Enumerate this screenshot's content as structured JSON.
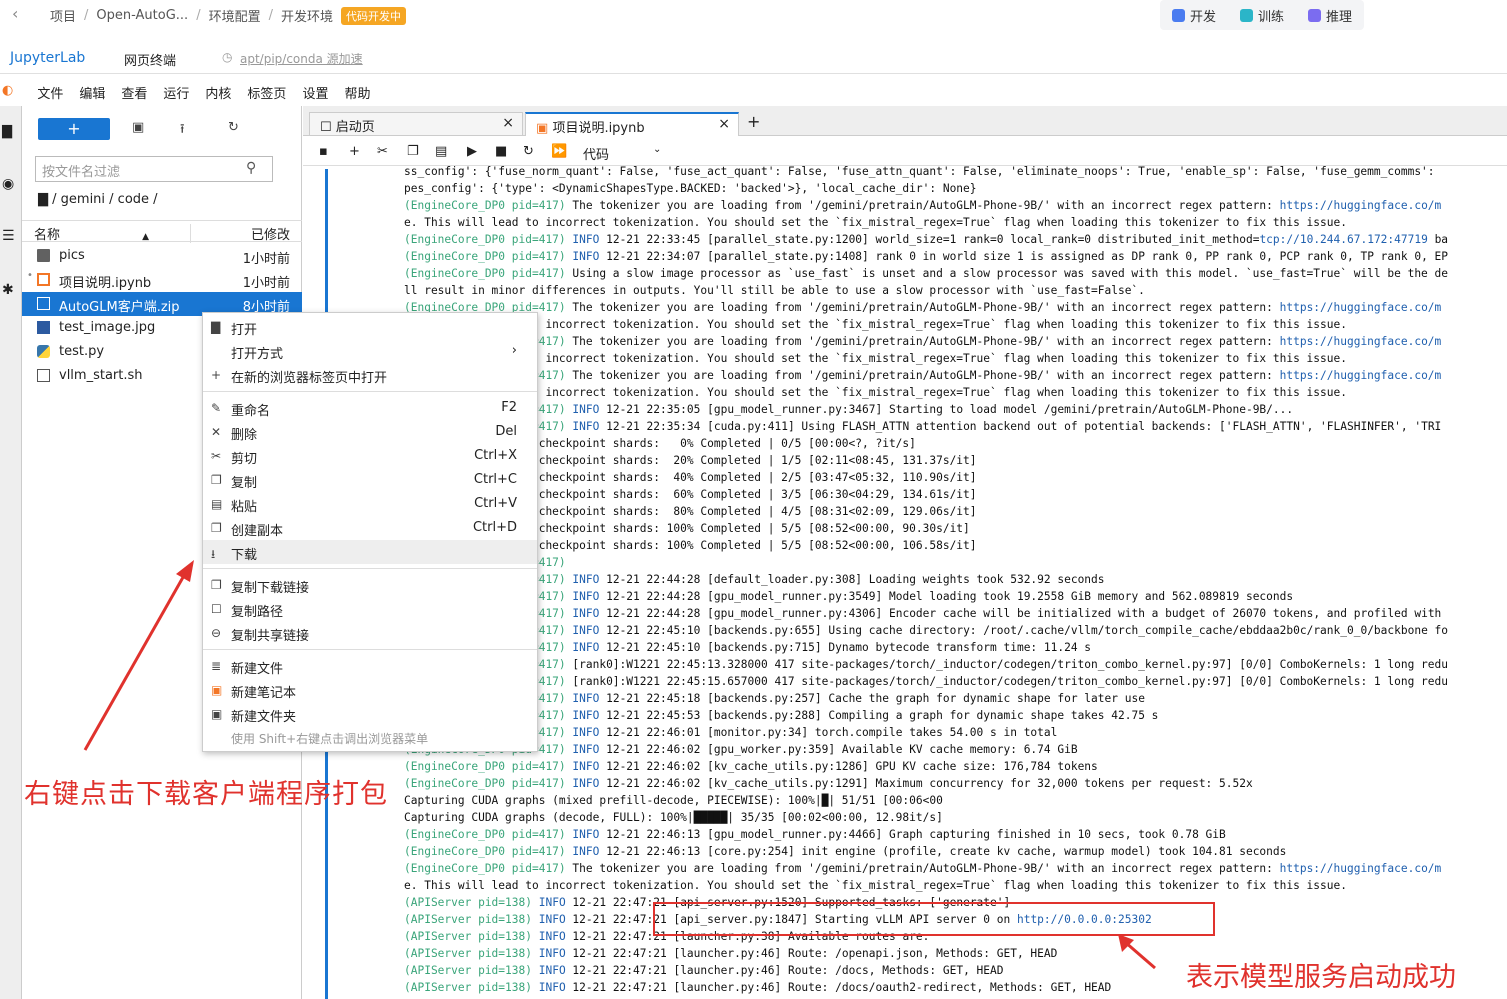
{
  "topbar": {
    "back_icon": "chevron-left-icon",
    "breadcrumb": [
      "项目",
      "Open-AutoG...",
      "环境配置",
      "开发环境"
    ],
    "status_badge": "代码开发中",
    "modes": [
      {
        "label": "开发",
        "color": "#4a7cf0"
      },
      {
        "label": "训练",
        "color": "#2bb5c8"
      },
      {
        "label": "推理",
        "color": "#7b6cf0"
      }
    ]
  },
  "jl": {
    "title": "JupyterLab",
    "terminal": "网页终端",
    "mirror": "apt/pip/conda 源加速"
  },
  "menu": [
    "文件",
    "编辑",
    "查看",
    "运行",
    "内核",
    "标签页",
    "设置",
    "帮助"
  ],
  "filebrowser": {
    "new_label": "+",
    "filter_placeholder": "按文件名过滤",
    "path": "/ gemini / code /",
    "col_name": "名称",
    "col_modified": "已修改",
    "files": [
      {
        "name": "pics",
        "modified": "1小时前",
        "icon": "folder-icon"
      },
      {
        "name": "项目说明.ipynb",
        "modified": "1小时前",
        "icon": "notebook-icon"
      },
      {
        "name": "AutoGLM客户端.zip",
        "modified": "8小时前",
        "icon": "file-icon"
      },
      {
        "name": "test_image.jpg",
        "modified": "",
        "icon": "image-icon"
      },
      {
        "name": "test.py",
        "modified": "",
        "icon": "python-icon"
      },
      {
        "name": "vllm_start.sh",
        "modified": "",
        "icon": "file-icon"
      }
    ]
  },
  "tabs": [
    {
      "label": "启动页",
      "close": "×"
    },
    {
      "label": "项目说明.ipynb",
      "close": "×"
    }
  ],
  "nb": {
    "cell_type": "代码",
    "add_tab": "+"
  },
  "context_menu": [
    {
      "label": "打开",
      "key": "",
      "icon": "folder-icon"
    },
    {
      "label": "打开方式",
      "key": "›",
      "icon": ""
    },
    {
      "label": "在新的浏览器标签页中打开",
      "key": "",
      "icon": "plus-icon"
    },
    {
      "label": "重命名",
      "key": "F2",
      "icon": "pencil-icon"
    },
    {
      "label": "删除",
      "key": "Del",
      "icon": "close-icon"
    },
    {
      "label": "剪切",
      "key": "Ctrl+X",
      "icon": "scissors-icon"
    },
    {
      "label": "复制",
      "key": "Ctrl+C",
      "icon": "copy-icon"
    },
    {
      "label": "粘贴",
      "key": "Ctrl+V",
      "icon": "paste-icon"
    },
    {
      "label": "创建副本",
      "key": "Ctrl+D",
      "icon": "duplicate-icon"
    },
    {
      "label": "下载",
      "key": "",
      "icon": "download-icon"
    },
    {
      "label": "复制下载链接",
      "key": "",
      "icon": "copy-icon"
    },
    {
      "label": "复制路径",
      "key": "",
      "icon": "file-icon"
    },
    {
      "label": "复制共享链接",
      "key": "",
      "icon": "link-icon"
    },
    {
      "label": "新建文件",
      "key": "",
      "icon": "text-file-icon"
    },
    {
      "label": "新建笔记本",
      "key": "",
      "icon": "notebook-icon"
    },
    {
      "label": "新建文件夹",
      "key": "",
      "icon": "new-folder-icon"
    },
    {
      "label": "使用 Shift+右键点击调出浏览器菜单",
      "key": "",
      "icon": ""
    }
  ],
  "annotations": {
    "left": "右键点击下载客户端程序打包",
    "right": "表示模型服务启动成功"
  },
  "output_lines": [
    "ss_config': {'fuse_norm_quant': False, 'fuse_act_quant': False, 'fuse_attn_quant': False, 'eliminate_noops': True, 'enable_sp': False, 'fuse_gemm_comms':",
    "pes_config': {'type': <DynamicShapesType.BACKED: 'backed'>}, 'local_cache_dir': None}",
    "(EngineCore_DP0 pid=417) The tokenizer you are loading from '/gemini/pretrain/AutoGLM-Phone-9B/' with an incorrect regex pattern: https://huggingface.co/m",
    "e. This will lead to incorrect tokenization. You should set the `fix_mistral_regex=True` flag when loading this tokenizer to fix this issue.",
    "(EngineCore_DP0 pid=417) INFO 12-21 22:33:45 [parallel_state.py:1200] world_size=1 rank=0 local_rank=0 distributed_init_method=tcp://10.244.67.172:47719 ba",
    "(EngineCore_DP0 pid=417) INFO 12-21 22:34:07 [parallel_state.py:1408] rank 0 in world size 1 is assigned as DP rank 0, PP rank 0, PCP rank 0, TP rank 0, EP",
    "(EngineCore_DP0 pid=417) Using a slow image processor as `use_fast` is unset and a slow processor was saved with this model. `use_fast=True` will be the de",
    "ll result in minor differences in outputs. You'll still be able to use a slow processor with `use_fast=False`.",
    "(EngineCore_DP0 pid=417) The tokenizer you are loading from '/gemini/pretrain/AutoGLM-Phone-9B/' with an incorrect regex pattern: https://huggingface.co/m",
    "e. This will lead to incorrect tokenization. You should set the `fix_mistral_regex=True` flag when loading this tokenizer to fix this issue.",
    "(EngineCore_DP0 pid=417) The tokenizer you are loading from '/gemini/pretrain/AutoGLM-Phone-9B/' with an incorrect regex pattern: https://huggingface.co/m",
    "e. This will lead to incorrect tokenization. You should set the `fix_mistral_regex=True` flag when loading this tokenizer to fix this issue.",
    "(EngineCore_DP0 pid=417) The tokenizer you are loading from '/gemini/pretrain/AutoGLM-Phone-9B/' with an incorrect regex pattern: https://huggingface.co/m",
    "e. This will lead to incorrect tokenization. You should set the `fix_mistral_regex=True` flag when loading this tokenizer to fix this issue.",
    "(EngineCore_DP0 pid=417) INFO 12-21 22:35:05 [gpu_model_runner.py:3467] Starting to load model /gemini/pretrain/AutoGLM-Phone-9B/...",
    "(EngineCore_DP0 pid=417) INFO 12-21 22:35:34 [cuda.py:411] Using FLASH_ATTN attention backend out of potential backends: ['FLASH_ATTN', 'FLASHINFER', 'TRI",
    "Loading safetensors checkpoint shards:   0% Completed | 0/5 [00:00<?, ?it/s]",
    "Loading safetensors checkpoint shards:  20% Completed | 1/5 [02:11<08:45, 131.37s/it]",
    "Loading safetensors checkpoint shards:  40% Completed | 2/5 [03:47<05:32, 110.90s/it]",
    "Loading safetensors checkpoint shards:  60% Completed | 3/5 [06:30<04:29, 134.61s/it]",
    "Loading safetensors checkpoint shards:  80% Completed | 4/5 [08:31<02:09, 129.06s/it]",
    "Loading safetensors checkpoint shards: 100% Completed | 5/5 [08:52<00:00, 90.30s/it]",
    "Loading safetensors checkpoint shards: 100% Completed | 5/5 [08:52<00:00, 106.58s/it]",
    "(EngineCore_DP0 pid=417)",
    "(EngineCore_DP0 pid=417) INFO 12-21 22:44:28 [default_loader.py:308] Loading weights took 532.92 seconds",
    "(EngineCore_DP0 pid=417) INFO 12-21 22:44:28 [gpu_model_runner.py:3549] Model loading took 19.2558 GiB memory and 562.089819 seconds",
    "(EngineCore_DP0 pid=417) INFO 12-21 22:44:28 [gpu_model_runner.py:4306] Encoder cache will be initialized with a budget of 26070 tokens, and profiled with",
    "(EngineCore_DP0 pid=417) INFO 12-21 22:45:10 [backends.py:655] Using cache directory: /root/.cache/vllm/torch_compile_cache/ebddaa2b0c/rank_0_0/backbone fo",
    "(EngineCore_DP0 pid=417) INFO 12-21 22:45:10 [backends.py:715] Dynamo bytecode transform time: 11.24 s",
    "(EngineCore_DP0 pid=417) [rank0]:W1221 22:45:13.328000 417 site-packages/torch/_inductor/codegen/triton_combo_kernel.py:97] [0/0] ComboKernels: 1 long redu",
    "(EngineCore_DP0 pid=417) [rank0]:W1221 22:45:15.657000 417 site-packages/torch/_inductor/codegen/triton_combo_kernel.py:97] [0/0] ComboKernels: 1 long redu",
    "(EngineCore_DP0 pid=417) INFO 12-21 22:45:18 [backends.py:257] Cache the graph for dynamic shape for later use",
    "(EngineCore_DP0 pid=417) INFO 12-21 22:45:53 [backends.py:288] Compiling a graph for dynamic shape takes 42.75 s",
    "(EngineCore_DP0 pid=417) INFO 12-21 22:46:01 [monitor.py:34] torch.compile takes 54.00 s in total",
    "(EngineCore_DP0 pid=417) INFO 12-21 22:46:02 [gpu_worker.py:359] Available KV cache memory: 6.74 GiB",
    "(EngineCore_DP0 pid=417) INFO 12-21 22:46:02 [kv_cache_utils.py:1286] GPU KV cache size: 176,784 tokens",
    "(EngineCore_DP0 pid=417) INFO 12-21 22:46:02 [kv_cache_utils.py:1291] Maximum concurrency for 32,000 tokens per request: 5.52x",
    "Capturing CUDA graphs (mixed prefill-decode, PIECEWISE): 100%|█| 51/51 [00:06<00",
    "Capturing CUDA graphs (decode, FULL): 100%|█████| 35/35 [00:02<00:00, 12.98it/s]",
    "(EngineCore_DP0 pid=417) INFO 12-21 22:46:13 [gpu_model_runner.py:4466] Graph capturing finished in 10 secs, took 0.78 GiB",
    "(EngineCore_DP0 pid=417) INFO 12-21 22:46:13 [core.py:254] init engine (profile, create kv cache, warmup model) took 104.81 seconds",
    "(EngineCore_DP0 pid=417) The tokenizer you are loading from '/gemini/pretrain/AutoGLM-Phone-9B/' with an incorrect regex pattern: https://huggingface.co/m",
    "e. This will lead to incorrect tokenization. You should set the `fix_mistral_regex=True` flag when loading this tokenizer to fix this issue.",
    "(APIServer pid=138) INFO 12-21 22:47:21 [api_server.py:1520] Supported_tasks: ['generate']",
    "(APIServer pid=138) INFO 12-21 22:47:21 [api_server.py:1847] Starting vLLM API server 0 on http://0.0.0.0:25302",
    "(APIServer pid=138) INFO 12-21 22:47:21 [launcher.py:38] Available routes are:",
    "(APIServer pid=138) INFO 12-21 22:47:21 [launcher.py:46] Route: /openapi.json, Methods: GET, HEAD",
    "(APIServer pid=138) INFO 12-21 22:47:21 [launcher.py:46] Route: /docs, Methods: GET, HEAD",
    "(APIServer pid=138) INFO 12-21 22:47:21 [launcher.py:46] Route: /docs/oauth2-redirect, Methods: GET, HEAD"
  ]
}
